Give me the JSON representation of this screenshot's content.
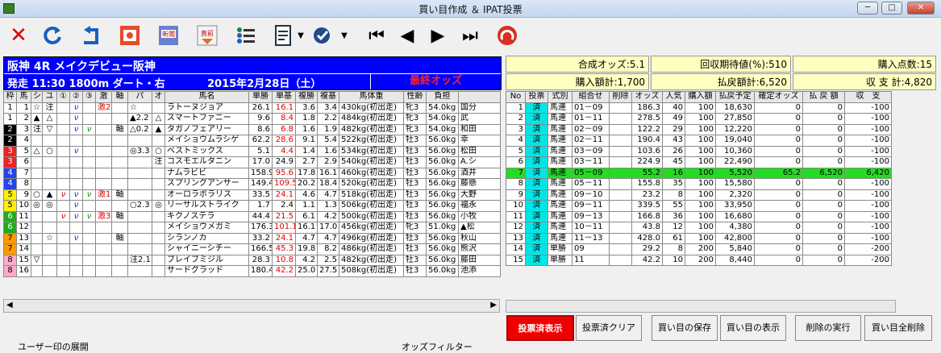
{
  "window": {
    "title": "買い目作成 ＆ IPAT投票"
  },
  "race": {
    "name": "阪神 4R メイクデビュー阪神",
    "line2": "発走 11:30 1800m ダート・右",
    "date": "2015年2月28日（土）",
    "odds_label": "最終オッズ"
  },
  "horse_headers": [
    "枠",
    "馬",
    "シ",
    "ユ",
    "①",
    "②",
    "③",
    "激",
    "軸",
    "パ",
    "オ",
    "馬名",
    "単勝",
    "単基",
    "複勝",
    "複基",
    "馬体重",
    "性齢",
    "負担",
    ""
  ],
  "horses": [
    {
      "waku": "1",
      "wc": "#ffffff",
      "wt": "#000",
      "no": "1",
      "shi": "☆",
      "yu": "注",
      "m1": "",
      "m2": "ν",
      "m3": "",
      "geki": "激2",
      "jiku": "",
      "pa": "☆",
      "o": "",
      "name": "ラトーヌジョア",
      "tan": "26.1",
      "tanki": "16.1",
      "fuku": "3.6",
      "fukuki": "3.4",
      "weight": "430kg(初出走)",
      "sex": "牝3",
      "load": "54.0kg",
      "extra": "国分"
    },
    {
      "waku": "1",
      "wc": "#ffffff",
      "wt": "#000",
      "no": "2",
      "shi": "▲",
      "yu": "△",
      "m1": "",
      "m2": "ν",
      "m3": "",
      "geki": "",
      "jiku": "",
      "pa": "▲2.2",
      "o": "△",
      "name": "スマートファニー",
      "tan": "9.6",
      "tanki": "8.4",
      "fuku": "1.8",
      "fukuki": "2.2",
      "weight": "484kg(初出走)",
      "sex": "牝3",
      "load": "54.0kg",
      "extra": "武"
    },
    {
      "waku": "2",
      "wc": "#000000",
      "wt": "#fff",
      "no": "3",
      "shi": "注",
      "yu": "▽",
      "m1": "",
      "m2": "ν",
      "m3": "ν",
      "geki": "",
      "jiku": "軸",
      "pa": "△0.2",
      "o": "▲",
      "name": "タガノフェアリー",
      "tan": "8.6",
      "tanki": "6.8",
      "fuku": "1.6",
      "fukuki": "1.9",
      "weight": "482kg(初出走)",
      "sex": "牝3",
      "load": "54.0kg",
      "extra": "和田"
    },
    {
      "waku": "2",
      "wc": "#000000",
      "wt": "#fff",
      "no": "4",
      "shi": "",
      "yu": "",
      "m1": "",
      "m2": "",
      "m3": "",
      "geki": "",
      "jiku": "",
      "pa": "",
      "o": "",
      "name": "メイショウムラシゲ",
      "tan": "62.2",
      "tanki": "28.6",
      "fuku": "9.1",
      "fukuki": "5.4",
      "weight": "522kg(初出走)",
      "sex": "牡3",
      "load": "56.0kg",
      "extra": "幸"
    },
    {
      "waku": "3",
      "wc": "#ee2222",
      "wt": "#fff",
      "no": "5",
      "shi": "△",
      "yu": "○",
      "m1": "",
      "m2": "ν",
      "m3": "",
      "geki": "",
      "jiku": "",
      "pa": "◎3.3",
      "o": "○",
      "name": "ベストミックス",
      "tan": "5.1",
      "tanki": "4.4",
      "fuku": "1.4",
      "fukuki": "1.6",
      "weight": "534kg(初出走)",
      "sex": "牡3",
      "load": "56.0kg",
      "extra": "松田"
    },
    {
      "waku": "3",
      "wc": "#ee2222",
      "wt": "#fff",
      "no": "6",
      "shi": "",
      "yu": "",
      "m1": "",
      "m2": "",
      "m3": "",
      "geki": "",
      "jiku": "",
      "pa": "",
      "o": "注",
      "name": "コスモエルタニン",
      "tan": "17.0",
      "tanki": "24.9",
      "fuku": "2.7",
      "fukuki": "2.9",
      "weight": "540kg(初出走)",
      "sex": "牡3",
      "load": "56.0kg",
      "extra": "A.シ"
    },
    {
      "waku": "4",
      "wc": "#2244ee",
      "wt": "#fff",
      "no": "7",
      "shi": "",
      "yu": "",
      "m1": "",
      "m2": "",
      "m3": "",
      "geki": "",
      "jiku": "",
      "pa": "",
      "o": "",
      "name": "ナムラビビ",
      "tan": "158.9",
      "tanki": "95.6",
      "fuku": "17.8",
      "fukuki": "16.1",
      "weight": "460kg(初出走)",
      "sex": "牡3",
      "load": "56.0kg",
      "extra": "酒井"
    },
    {
      "waku": "4",
      "wc": "#2244ee",
      "wt": "#fff",
      "no": "8",
      "shi": "",
      "yu": "",
      "m1": "",
      "m2": "",
      "m3": "",
      "geki": "",
      "jiku": "",
      "pa": "",
      "o": "",
      "name": "スプリングアンサー",
      "tan": "149.4",
      "tanki": "109.5",
      "fuku": "20.2",
      "fukuki": "18.4",
      "weight": "520kg(初出走)",
      "sex": "牡3",
      "load": "56.0kg",
      "extra": "藤懸"
    },
    {
      "waku": "5",
      "wc": "#ffee00",
      "wt": "#000",
      "no": "9",
      "shi": "○",
      "yu": "▲",
      "m1": "ν",
      "m2": "ν",
      "m3": "ν",
      "geki": "激1",
      "jiku": "軸",
      "pa": "",
      "o": "",
      "name": "オーロラボラリス",
      "tan": "33.5",
      "tanki": "24.1",
      "fuku": "4.6",
      "fukuki": "4.7",
      "weight": "518kg(初出走)",
      "sex": "牡3",
      "load": "56.0kg",
      "extra": "大野"
    },
    {
      "waku": "5",
      "wc": "#ffee00",
      "wt": "#000",
      "no": "10",
      "shi": "◎",
      "yu": "◎",
      "m1": "",
      "m2": "ν",
      "m3": "",
      "geki": "",
      "jiku": "",
      "pa": "○2.3",
      "o": "◎",
      "name": "リーサルストライク",
      "tan": "1.7",
      "tanki": "2.4",
      "fuku": "1.1",
      "fukuki": "1.3",
      "weight": "506kg(初出走)",
      "sex": "牡3",
      "load": "56.0kg",
      "extra": "福永"
    },
    {
      "waku": "6",
      "wc": "#22aa22",
      "wt": "#fff",
      "no": "11",
      "shi": "",
      "yu": "",
      "m1": "ν",
      "m2": "ν",
      "m3": "ν",
      "geki": "激3",
      "jiku": "軸",
      "pa": "",
      "o": "",
      "name": "キクノステラ",
      "tan": "44.4",
      "tanki": "21.5",
      "fuku": "6.1",
      "fukuki": "4.2",
      "weight": "500kg(初出走)",
      "sex": "牡3",
      "load": "56.0kg",
      "extra": "小牧"
    },
    {
      "waku": "6",
      "wc": "#22aa22",
      "wt": "#fff",
      "no": "12",
      "shi": "",
      "yu": "",
      "m1": "",
      "m2": "",
      "m3": "",
      "geki": "",
      "jiku": "",
      "pa": "",
      "o": "",
      "name": "メイショウメガミ",
      "tan": "176.3",
      "tanki": "101.1",
      "fuku": "16.1",
      "fukuki": "17.0",
      "weight": "456kg(初出走)",
      "sex": "牝3",
      "load": "51.0kg",
      "extra": "▲松"
    },
    {
      "waku": "7",
      "wc": "#ff9900",
      "wt": "#000",
      "no": "13",
      "shi": "",
      "yu": "☆",
      "m1": "",
      "m2": "ν",
      "m3": "",
      "geki": "",
      "jiku": "軸",
      "pa": "",
      "o": "",
      "name": "シランノカ",
      "tan": "33.2",
      "tanki": "24.1",
      "fuku": "4.7",
      "fukuki": "4.7",
      "weight": "496kg(初出走)",
      "sex": "牡3",
      "load": "56.0kg",
      "extra": "秋山"
    },
    {
      "waku": "7",
      "wc": "#ff9900",
      "wt": "#000",
      "no": "14",
      "shi": "",
      "yu": "",
      "m1": "",
      "m2": "",
      "m3": "",
      "geki": "",
      "jiku": "",
      "pa": "",
      "o": "",
      "name": "シャイニーシチー",
      "tan": "166.5",
      "tanki": "45.3",
      "fuku": "19.8",
      "fukuki": "8.2",
      "weight": "486kg(初出走)",
      "sex": "牡3",
      "load": "56.0kg",
      "extra": "熊沢"
    },
    {
      "waku": "8",
      "wc": "#ffaacc",
      "wt": "#000",
      "no": "15",
      "shi": "▽",
      "yu": "",
      "m1": "",
      "m2": "",
      "m3": "",
      "geki": "",
      "jiku": "",
      "pa": "注2.1",
      "o": "",
      "name": "ブレイブミジル",
      "tan": "28.3",
      "tanki": "10.8",
      "fuku": "4.2",
      "fukuki": "2.5",
      "weight": "482kg(初出走)",
      "sex": "牡3",
      "load": "56.0kg",
      "extra": "藤田"
    },
    {
      "waku": "8",
      "wc": "#ffaacc",
      "wt": "#000",
      "no": "16",
      "shi": "",
      "yu": "",
      "m1": "",
      "m2": "",
      "m3": "",
      "geki": "",
      "jiku": "",
      "pa": "",
      "o": "",
      "name": "サードグラッド",
      "tan": "180.4",
      "tanki": "42.2",
      "fuku": "25.0",
      "fukuki": "27.5",
      "weight": "508kg(初出走)",
      "sex": "牡3",
      "load": "56.0kg",
      "extra": "池添"
    }
  ],
  "summary": {
    "gousei": "合成オッズ:5.1",
    "kaishu": "回収期待値(%):510",
    "tensu": "購入点数:15",
    "kounyu": "購入額計:1,700",
    "haraimodoshi": "払戻額計:6,520",
    "shushi": "収 支 計:4,820"
  },
  "bet_headers": [
    "No",
    "投票",
    "式別",
    "組合せ",
    "削除",
    "オッズ",
    "人気",
    "購入額",
    "払戻予定",
    "確定オッズ",
    "払 戻 額",
    "収　支"
  ],
  "bets": [
    [
      "1",
      "済",
      "馬連",
      "01－09",
      "",
      "186.3",
      "40",
      "100",
      "18,630",
      "0",
      "0",
      "-100"
    ],
    [
      "2",
      "済",
      "馬連",
      "01－11",
      "",
      "278.5",
      "49",
      "100",
      "27,850",
      "0",
      "0",
      "-100"
    ],
    [
      "3",
      "済",
      "馬連",
      "02－09",
      "",
      "122.2",
      "29",
      "100",
      "12,220",
      "0",
      "0",
      "-100"
    ],
    [
      "4",
      "済",
      "馬連",
      "02－11",
      "",
      "190.4",
      "43",
      "100",
      "19,040",
      "0",
      "0",
      "-100"
    ],
    [
      "5",
      "済",
      "馬連",
      "03－09",
      "",
      "103.6",
      "26",
      "100",
      "10,360",
      "0",
      "0",
      "-100"
    ],
    [
      "6",
      "済",
      "馬連",
      "03－11",
      "",
      "224.9",
      "45",
      "100",
      "22,490",
      "0",
      "0",
      "-100"
    ],
    [
      "7",
      "済",
      "馬連",
      "05－09",
      "",
      "55.2",
      "16",
      "100",
      "5,520",
      "65.2",
      "6,520",
      "6,420"
    ],
    [
      "8",
      "済",
      "馬連",
      "05－11",
      "",
      "155.8",
      "35",
      "100",
      "15,580",
      "0",
      "0",
      "-100"
    ],
    [
      "9",
      "済",
      "馬連",
      "09－10",
      "",
      "23.2",
      "8",
      "100",
      "2,320",
      "0",
      "0",
      "-100"
    ],
    [
      "10",
      "済",
      "馬連",
      "09－11",
      "",
      "339.5",
      "55",
      "100",
      "33,950",
      "0",
      "0",
      "-100"
    ],
    [
      "11",
      "済",
      "馬連",
      "09－13",
      "",
      "166.8",
      "36",
      "100",
      "16,680",
      "0",
      "0",
      "-100"
    ],
    [
      "12",
      "済",
      "馬連",
      "10－11",
      "",
      "43.8",
      "12",
      "100",
      "4,380",
      "0",
      "0",
      "-100"
    ],
    [
      "13",
      "済",
      "馬連",
      "11－13",
      "",
      "428.0",
      "61",
      "100",
      "42,800",
      "0",
      "0",
      "-100"
    ],
    [
      "14",
      "済",
      "単勝",
      "09",
      "",
      "29.2",
      "8",
      "200",
      "5,840",
      "0",
      "0",
      "-200"
    ],
    [
      "15",
      "済",
      "単勝",
      "11",
      "",
      "42.2",
      "10",
      "200",
      "8,440",
      "0",
      "0",
      "-200"
    ]
  ],
  "highlight_row": "7",
  "buttons": {
    "show": "投票済表示",
    "clear": "投票済クリア",
    "save": "買い目の保存",
    "display": "買い目の表示",
    "delete": "削除の実行",
    "delete_all": "買い目全削除"
  },
  "below": {
    "left": "ユーザー印の展開",
    "right": "オッズフィルター"
  },
  "colors": {
    "race_panel": "#0000ff",
    "odds_label": "#ff2020",
    "highlight": "#22dd22",
    "sumi": "#00e5e5",
    "show_button": "#ee0000"
  }
}
